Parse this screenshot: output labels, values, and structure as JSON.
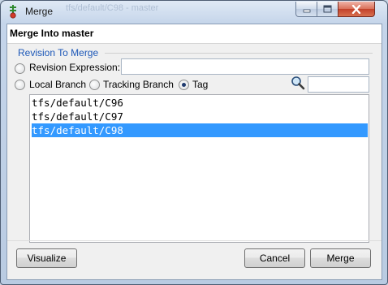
{
  "window": {
    "title": "Merge",
    "ghost_title": "tfs/default/C98 - master",
    "icons": {
      "app": "merge-app-icon",
      "minimize": "minimize-icon",
      "maximize": "maximize-icon",
      "close": "close-icon"
    }
  },
  "dialog": {
    "heading": "Merge Into master",
    "group_label": "Revision To Merge",
    "options": {
      "revision_expression": {
        "label": "Revision Expression:",
        "checked": false,
        "value": ""
      },
      "local_branch": {
        "label": "Local Branch",
        "checked": false
      },
      "tracking_branch": {
        "label": "Tracking Branch",
        "checked": false
      },
      "tag": {
        "label": "Tag",
        "checked": true
      }
    },
    "search": {
      "icon": "search-icon",
      "value": ""
    },
    "tags": [
      {
        "name": "tfs/default/C96",
        "selected": false
      },
      {
        "name": "tfs/default/C97",
        "selected": false
      },
      {
        "name": "tfs/default/C98",
        "selected": true
      }
    ],
    "buttons": {
      "visualize": "Visualize",
      "cancel": "Cancel",
      "merge": "Merge"
    }
  },
  "colors": {
    "selection": "#3399ff",
    "group_label": "#1d58b8",
    "close_button": "#c3412a"
  }
}
